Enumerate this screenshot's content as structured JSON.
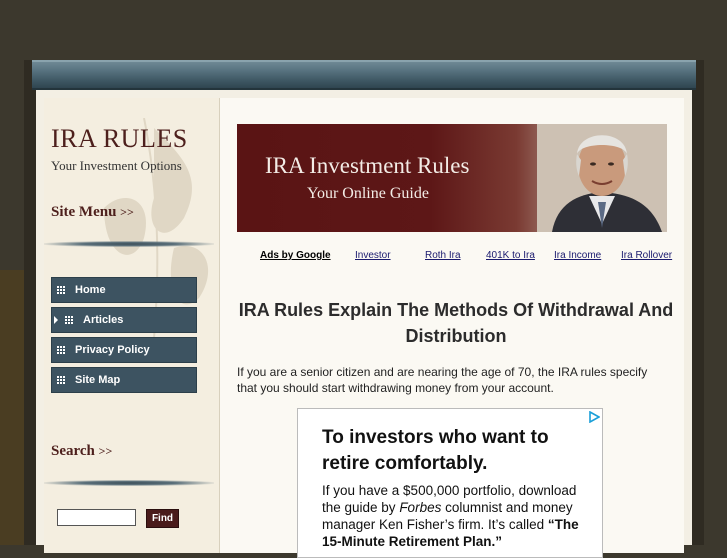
{
  "site": {
    "title": "IRA RULES",
    "subtitle": "Your Investment Options"
  },
  "sidebar": {
    "menu_heading": "Site Menu",
    "menu_heading_arrows": ">>",
    "menu_items": [
      {
        "label": "Home",
        "expandable": false
      },
      {
        "label": "Articles",
        "expandable": true
      },
      {
        "label": "Privacy Policy",
        "expandable": false
      },
      {
        "label": "Site Map",
        "expandable": false
      }
    ],
    "search_heading": "Search",
    "search_heading_arrows": ">>",
    "search_value": "",
    "find_label": "Find"
  },
  "banner": {
    "title": "IRA Investment Rules",
    "subtitle": "Your Online Guide"
  },
  "ads_bar": {
    "label": "Ads by Google",
    "links": [
      "Investor",
      "Roth Ira",
      "401K to Ira",
      "Ira Income",
      "Ira Rollover"
    ]
  },
  "article": {
    "title": "IRA Rules Explain The Methods Of Withdrawal And Distribution",
    "intro": "If you are a senior citizen and are nearing the age of 70, the IRA rules specify that you should start withdrawing money from your account."
  },
  "ad": {
    "headline": "To investors who want to retire comfortably.",
    "text_before": "If you have a $500,000 portfolio, download the guide by ",
    "text_italic": "Forbes",
    "text_mid": " columnist and money manager Ken Fisher’s firm. It’s called ",
    "text_bold": "“The 15-Minute Retirement Plan.”"
  },
  "colors": {
    "accent": "#4d1f1c",
    "menu_bg": "#3d5361",
    "banner_bg": "#5a1414"
  }
}
